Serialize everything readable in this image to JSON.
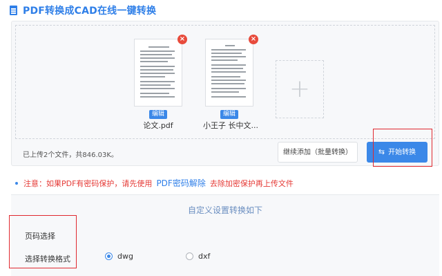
{
  "header": {
    "title": "PDF转换成CAD在线一键转换",
    "icon": "document-icon"
  },
  "upload": {
    "files": [
      {
        "name": "论文.pdf",
        "edit_label": "编辑",
        "remove": "×"
      },
      {
        "name": "小王子 长中文...",
        "edit_label": "编辑",
        "remove": "×"
      }
    ],
    "add_symbol": "+",
    "summary": "已上传2个文件，共846.03K。",
    "continue_label": "继续添加（批量转换）",
    "start_icon": "⇆",
    "start_label": "开始转换"
  },
  "notice": {
    "prefix": "注意：如果PDF有密码保护，请先使用",
    "link": "PDF密码解除",
    "suffix": "去除加密保护再上传文件"
  },
  "settings": {
    "title": "自定义设置转换如下",
    "page_select_label": "页码选择",
    "format_label": "选择转换格式",
    "formats": [
      {
        "label": "dwg",
        "selected": true
      },
      {
        "label": "dxf",
        "selected": false
      }
    ]
  },
  "colors": {
    "accent": "#3b88e8",
    "warning": "#e53935",
    "highlight": "#e0282e"
  }
}
